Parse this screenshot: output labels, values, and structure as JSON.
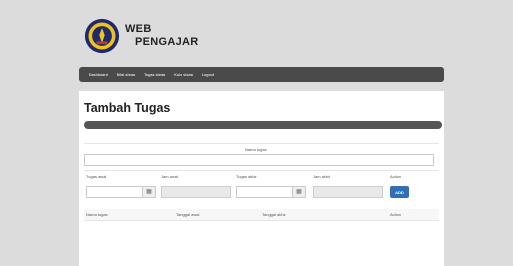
{
  "brand": {
    "line1": "WEB",
    "line2": "PENGAJAR"
  },
  "nav": [
    "Dashboard",
    "Nilai siswa",
    "Tugas siswa",
    "Kuis siswa",
    "Logout"
  ],
  "page": {
    "title": "Tambah Tugas"
  },
  "form": {
    "nama_tugas_label": "Nama tugas",
    "tugas_awal_label": "Tugas awal",
    "jam_awal_label": "Jam awal",
    "tugas_akhir_label": "Tugas akhir",
    "jam_akhir_label": "Jam akhir",
    "action_label": "Action",
    "add_button": "ADD"
  },
  "table": {
    "headers": [
      "Nama tugas",
      "Tanggal awal",
      "Tanggal akhir",
      "Action"
    ]
  },
  "colors": {
    "navbar": "#4a4a4a",
    "add_button": "#2f6fb6",
    "background": "#dcdcdc"
  }
}
